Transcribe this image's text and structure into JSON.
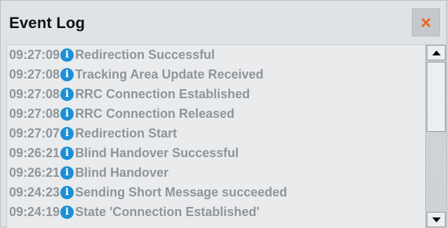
{
  "window": {
    "title": "Event Log",
    "close_label": "×",
    "accent_color": "#f0661a"
  },
  "log": {
    "icon": "info-icon",
    "icon_glyph": "i",
    "icon_color": "#1e8fd6",
    "entries": [
      {
        "time": "09:27:09",
        "message": "Redirection Successful"
      },
      {
        "time": "09:27:08",
        "message": "Tracking Area Update Received"
      },
      {
        "time": "09:27:08",
        "message": "RRC Connection Established"
      },
      {
        "time": "09:27:08",
        "message": "RRC Connection Released"
      },
      {
        "time": "09:27:07",
        "message": "Redirection Start"
      },
      {
        "time": "09:26:21",
        "message": "Blind Handover Successful"
      },
      {
        "time": "09:26:21",
        "message": "Blind Handover"
      },
      {
        "time": "09:24:23",
        "message": "Sending Short Message succeeded"
      },
      {
        "time": "09:24:19",
        "message": "State 'Connection Established'"
      }
    ]
  },
  "scrollbar": {
    "up_icon": "arrow-up-icon",
    "down_icon": "arrow-down-icon"
  }
}
